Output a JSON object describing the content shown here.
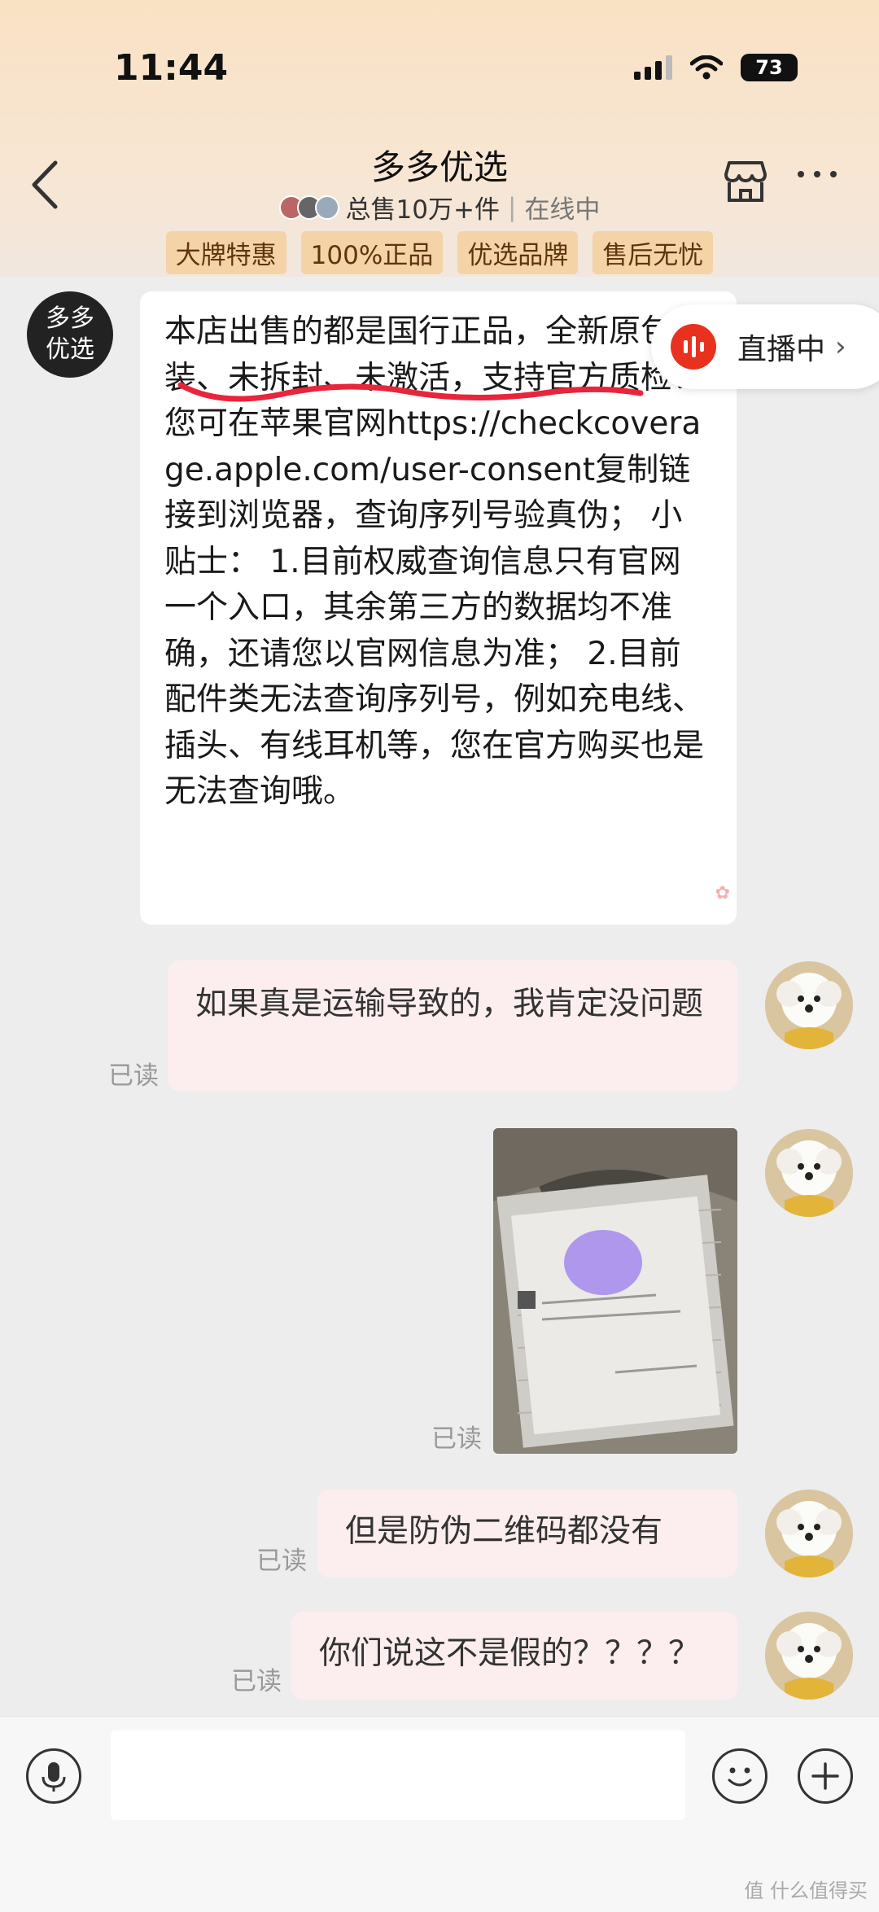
{
  "status_bar": {
    "time": "11:44",
    "battery": "73"
  },
  "header": {
    "title": "多多优选",
    "sales": "总售10万+件",
    "online_status": "在线中",
    "tags": [
      "大牌特惠",
      "100%正品",
      "优选品牌",
      "售后无忧"
    ]
  },
  "shop_message": {
    "avatar_text": "多多\n优选",
    "text": "本店出售的都是国行正品，全新原包装、未拆封、未激活，支持官方质检！您可在苹果官网https://checkcoverage.apple.com/user-consent复制链接到浏览器，查询序列号验真伪； 小贴士： 1.目前权威查询信息只有官网一个入口，其余第三方的数据均不准确，还请您以官网信息为准； 2.目前配件类无法查询序列号，例如充电线、插头、有线耳机等，您在官方购买也是无法查询哦。"
  },
  "live_badge": {
    "label": "直播中"
  },
  "user_messages": [
    {
      "text": "如果真是运输导致的，我肯定没问题",
      "read_label": "已读"
    },
    {
      "image": "photo-of-product-box",
      "read_label": "已读"
    },
    {
      "text": "但是防伪二维码都没有",
      "read_label": "已读"
    },
    {
      "text": "你们说这不是假的？？？？",
      "read_label": "已读"
    }
  ],
  "input_bar": {
    "placeholder": ""
  },
  "watermark": "值 什么值得买"
}
